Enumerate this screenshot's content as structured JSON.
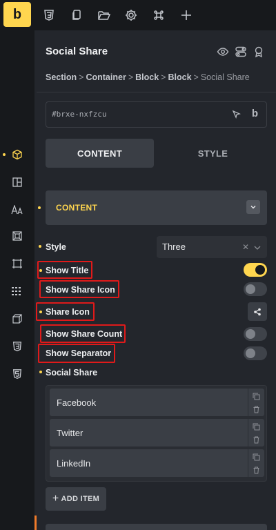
{
  "topbar": {
    "logo": "b",
    "icons": [
      "css3-icon",
      "copy-icon",
      "folder-open-icon",
      "gear-icon",
      "command-icon",
      "plus-icon"
    ]
  },
  "panel": {
    "title": "Social Share",
    "breadcrumb": [
      "Section",
      "Container",
      "Block",
      "Block",
      "Social Share"
    ],
    "element_id": "#brxe-nxfzcu",
    "id_action": "b",
    "tabs": [
      {
        "label": "CONTENT",
        "active": true
      },
      {
        "label": "STYLE",
        "active": false
      }
    ],
    "group": {
      "label": "CONTENT"
    },
    "fields": {
      "style": {
        "label": "Style",
        "value": "Three",
        "clear": "✕"
      },
      "show_title": {
        "label": "Show Title",
        "on": true
      },
      "show_share_icon": {
        "label": "Show Share Icon",
        "on": false
      },
      "share_icon": {
        "label": "Share Icon"
      },
      "show_share_count": {
        "label": "Show Share Count",
        "on": false
      },
      "show_separator": {
        "label": "Show Separator",
        "on": false
      },
      "social_share": {
        "label": "Social Share"
      }
    },
    "items": [
      "Facebook",
      "Twitter",
      "LinkedIn"
    ],
    "add_item": "ADD ITEM",
    "plus": "+"
  },
  "colors": {
    "accent": "#ffd64f",
    "highlight": "#e01a1a",
    "bg": "#23262c",
    "rail": "#17191c"
  }
}
